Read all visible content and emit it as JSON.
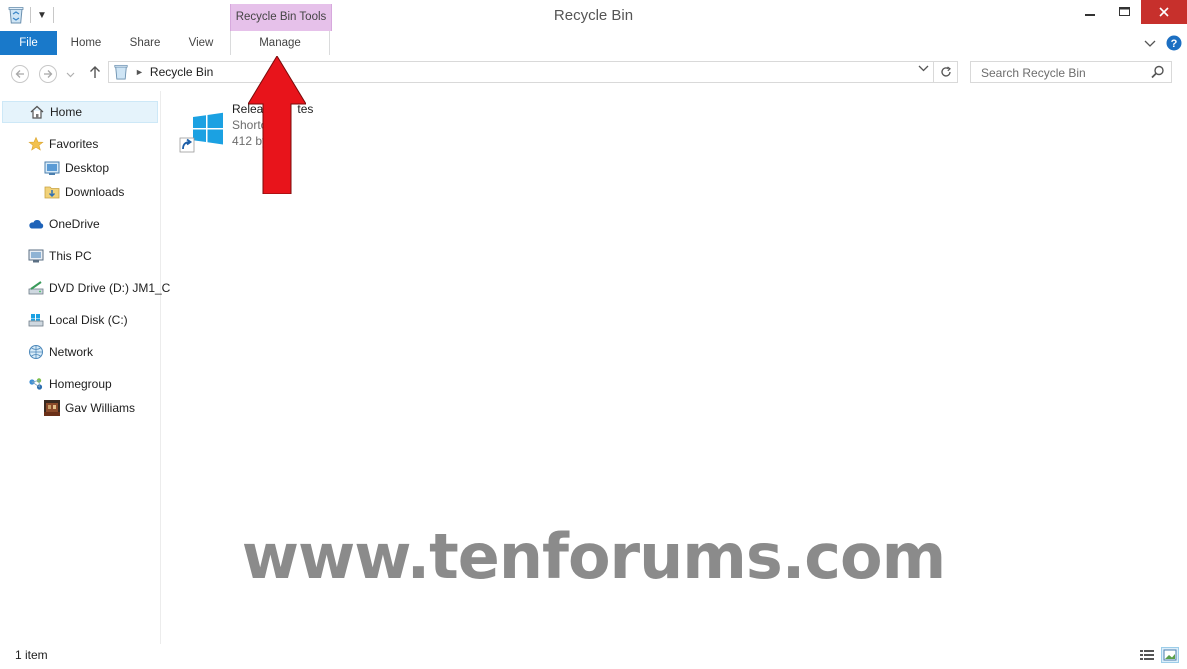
{
  "window": {
    "title": "Recycle Bin"
  },
  "ribbon": {
    "contextual_group": "Recycle Bin Tools",
    "tabs": [
      {
        "label": "File"
      },
      {
        "label": "Home"
      },
      {
        "label": "Share"
      },
      {
        "label": "View"
      },
      {
        "label": "Manage"
      }
    ],
    "help_icon": "help-icon",
    "expand_icon": "chevron-down-icon"
  },
  "address": {
    "path": "Recycle Bin",
    "search_placeholder": "Search Recycle Bin"
  },
  "nav": {
    "items": [
      {
        "label": "Home",
        "icon": "home-icon"
      },
      {
        "label": "Favorites",
        "icon": "star-icon"
      },
      {
        "label": "Desktop",
        "icon": "desktop-icon"
      },
      {
        "label": "Downloads",
        "icon": "downloads-icon"
      },
      {
        "label": "OneDrive",
        "icon": "cloud-icon"
      },
      {
        "label": "This PC",
        "icon": "computer-icon"
      },
      {
        "label": "DVD Drive (D:) JM1_C",
        "icon": "dvd-icon"
      },
      {
        "label": "Local Disk (C:)",
        "icon": "disk-icon"
      },
      {
        "label": "Network",
        "icon": "network-icon"
      },
      {
        "label": "Homegroup",
        "icon": "homegroup-icon"
      },
      {
        "label": "Gav Williams",
        "icon": "user-avatar-icon"
      }
    ]
  },
  "files": [
    {
      "name": "Releas",
      "name_tail": "tes",
      "type": "Shorto",
      "size": "412 by"
    }
  ],
  "watermark": "www.tenforums.com",
  "status": {
    "item_count": "1 item"
  },
  "colors": {
    "file_tab": "#1979ca",
    "contextual": "#e6c1ea",
    "close": "#c7302c",
    "arrow": "#e8141b"
  }
}
